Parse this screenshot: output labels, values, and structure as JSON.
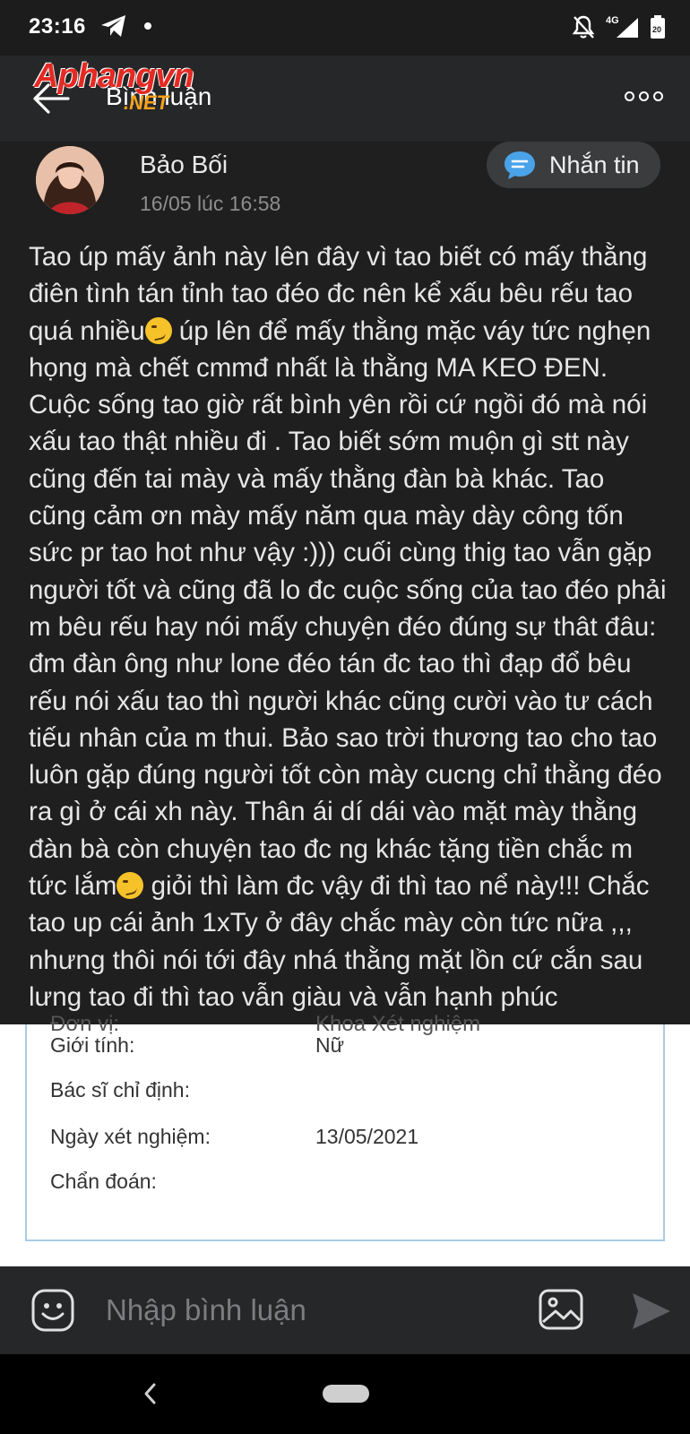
{
  "status_bar": {
    "time": "23:16",
    "icons": [
      "telegram-icon",
      "dot-icon",
      "notifications-off-icon",
      "signal-4g-icon",
      "battery-icon"
    ],
    "network": "4G",
    "battery": "20"
  },
  "watermark": {
    "brand": "Aphangvn",
    "suffix": ".NET"
  },
  "header": {
    "title": "Bình luận"
  },
  "comment": {
    "author": "Bảo Bối",
    "timestamp": "16/05 lúc 16:58",
    "message_button": "Nhắn tin",
    "body_part1": "Tao úp mấy ảnh này lên đây vì tao biết có mấy thằng điên tình tán tỉnh tao đéo đc nên kể xấu bêu rếu tao quá nhiều",
    "body_part2": " úp lên để mấy thằng mặc váy tức nghẹn họng mà chết cmmđ nhất là thằng MA KEO ĐEN. Cuộc sống tao giờ rất bình  yên rồi cứ ngồi đó mà nói xấu tao thật nhiều đi . Tao biết sớm muộn gì stt này cũng đến tai mày và mấy thằng đàn bà khác. Tao cũng cảm ơn mày mấy năm qua mày dày công tốn sức pr tao hot như vậy :))) cuối cùng thig tao vẫn gặp người tốt và cũng đã lo đc cuộc sống của tao đéo phải m bêu rếu hay nói mấy chuyện đéo đúng sự thât đâu: đm đàn ông như lone đéo tán đc tao thì đạp đổ bêu rếu nói xấu tao thì người khác cũng cười vào tư cách tiếu nhân của m thui. Bảo sao trời thương tao cho tao luôn gặp đúng người tốt còn mày cucng chỉ thằng đéo ra gì ở cái xh này. Thân ái dí dái vào mặt mày thằng đàn bà còn chuyện tao đc ng khác tặng tiền chắc m tức lắm",
    "body_part3": " giỏi thì làm đc vậy đi thì tao nể này!!! Chắc tao up cái ảnh 1xTy ở đây chắc mày còn tức nữa ,,, nhưng thôi nói tới đây nhá thằng mặt lồn cứ cắn sau lưng tao đi thì tao vẫn giàu và vẫn hạnh phúc",
    "heart": "❤"
  },
  "attachment": {
    "cut_label": "Đơn vị:",
    "cut_value": "Khoa Xét nghiệm",
    "rows": [
      {
        "label": "Giới tính:",
        "value": "Nữ"
      },
      {
        "label": "Bác sĩ chỉ định:",
        "value": ""
      },
      {
        "label": "Ngày xét nghiệm:",
        "value": "13/05/2021"
      },
      {
        "label": "Chẩn đoán:",
        "value": ""
      }
    ]
  },
  "input": {
    "placeholder": "Nhập bình luận"
  },
  "colors": {
    "header_bg": "#262728",
    "card_bg": "#1f1f1f",
    "button_bg": "#3a3c3e",
    "chat_icon": "#4aa3e8",
    "brand_red": "#e42a23",
    "brand_orange": "#f5a21a"
  }
}
